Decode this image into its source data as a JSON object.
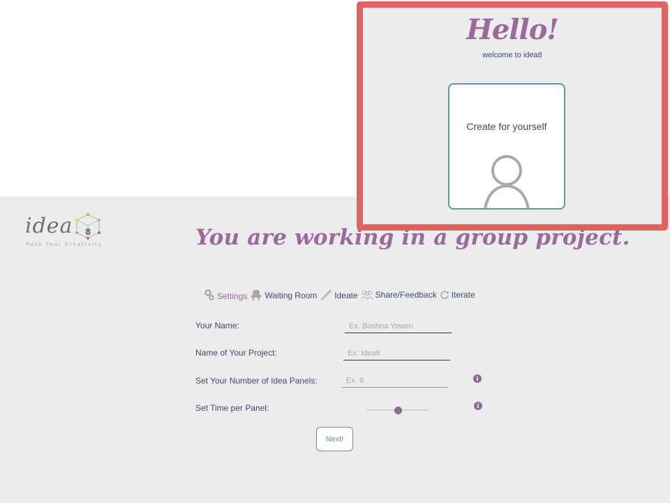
{
  "brand": {
    "logo_text": "idea",
    "logo_number": "8",
    "tagline": "Push Your Creativity"
  },
  "headline": "You are working in a group project.",
  "steps": [
    {
      "label": "Settings",
      "icon": "gears-icon",
      "active": true
    },
    {
      "label": "Waiting Room",
      "icon": "chair-icon",
      "active": false
    },
    {
      "label": "Ideate",
      "icon": "pencil-icon",
      "active": false
    },
    {
      "label": "Share/Feedback",
      "icon": "people-icon",
      "active": false
    },
    {
      "label": "Iterate",
      "icon": "refresh-icon",
      "active": false
    }
  ],
  "form": {
    "name": {
      "label": "Your Name:",
      "placeholder": "Ex. Boshna Yowen",
      "value": ""
    },
    "project": {
      "label": "Name of Your Project:",
      "placeholder": "Ex. Idea8",
      "value": ""
    },
    "panels": {
      "label": "Set Your Number of Idea Panels:",
      "placeholder": "Ex. 8",
      "value": ""
    },
    "time": {
      "label": "Set Time per Panel:",
      "slider_fraction": 0.5
    },
    "info_icon_glyph": "i",
    "next_label": "Next!"
  },
  "overlay": {
    "title": "Hello!",
    "subtitle": "welcome to idea8",
    "card_title": "Create for yourself",
    "card_icon": "person-icon"
  },
  "colors": {
    "purple": "#9b6a9c",
    "teal": "#5f9b97",
    "highlight_red": "#e06363",
    "text_navy": "#3f4a6a",
    "panel_grey": "#ececec"
  }
}
